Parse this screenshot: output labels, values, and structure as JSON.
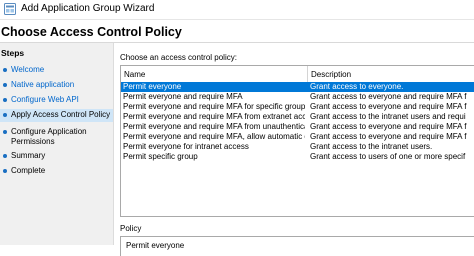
{
  "window": {
    "title": "Add Application Group Wizard"
  },
  "page": {
    "title": "Choose Access Control Policy"
  },
  "steps": {
    "title": "Steps",
    "items": [
      {
        "label": "Welcome",
        "state": "link"
      },
      {
        "label": "Native application",
        "state": "link"
      },
      {
        "label": "Configure Web API",
        "state": "link"
      },
      {
        "label": "Apply Access Control Policy",
        "state": "current"
      },
      {
        "label": "Configure Application Permissions",
        "state": "normal"
      },
      {
        "label": "Summary",
        "state": "normal"
      },
      {
        "label": "Complete",
        "state": "normal"
      }
    ]
  },
  "policy_list": {
    "label": "Choose an access control policy:",
    "columns": {
      "name": "Name",
      "description": "Description"
    },
    "rows": [
      {
        "name": "Permit everyone",
        "description": "Grant access to everyone.",
        "selected": true
      },
      {
        "name": "Permit everyone and require MFA",
        "description": "Grant access to everyone and require MFA f",
        "selected": false
      },
      {
        "name": "Permit everyone and require MFA for specific group",
        "description": "Grant access to everyone and require MFA f",
        "selected": false
      },
      {
        "name": "Permit everyone and require MFA from extranet access",
        "description": "Grant access to the intranet users and requi",
        "selected": false
      },
      {
        "name": "Permit everyone and require MFA from unauthenticated ...",
        "description": "Grant access to everyone and require MFA f",
        "selected": false
      },
      {
        "name": "Permit everyone and require MFA, allow automatic devi...",
        "description": "Grant access to everyone and require MFA f",
        "selected": false
      },
      {
        "name": "Permit everyone for intranet access",
        "description": "Grant access to the intranet users.",
        "selected": false
      },
      {
        "name": "Permit specific group",
        "description": "Grant access to users of one or more specif",
        "selected": false
      }
    ]
  },
  "policy": {
    "label": "Policy",
    "text": "Permit everyone"
  },
  "colors": {
    "accent": "#0078d7",
    "link": "#0066cc",
    "current_step_bg": "#cfe5f7"
  },
  "icons": {
    "title_icon": "wizard-app-icon",
    "step_bullet": "step-bullet-icon"
  }
}
